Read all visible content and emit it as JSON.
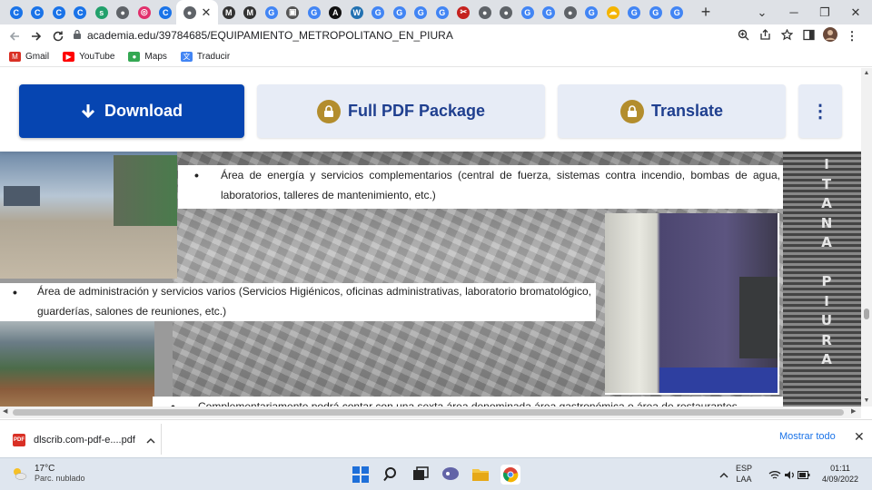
{
  "tabs": {
    "favicons": [
      {
        "name": "chrome-tab-icon",
        "color": "#1a73e8",
        "glyph": "C"
      },
      {
        "name": "chrome-tab-icon",
        "color": "#1a73e8",
        "glyph": "C"
      },
      {
        "name": "chrome-tab-icon",
        "color": "#1a73e8",
        "glyph": "C"
      },
      {
        "name": "chrome-tab-icon",
        "color": "#1a73e8",
        "glyph": "C"
      },
      {
        "name": "scribd-tab-icon",
        "color": "#22a06b",
        "glyph": "s"
      },
      {
        "name": "globe-tab-icon",
        "color": "#5f6368",
        "glyph": "●"
      },
      {
        "name": "instagram-tab-icon",
        "color": "#e1306c",
        "glyph": "◎"
      },
      {
        "name": "chrome-tab-icon",
        "color": "#1a73e8",
        "glyph": "C"
      },
      {
        "name": "globe-tab-icon",
        "color": "#5f6368",
        "glyph": "●"
      },
      {
        "name": "m-tab-icon",
        "color": "#333333",
        "glyph": "M"
      },
      {
        "name": "m-tab-icon",
        "color": "#333333",
        "glyph": "M"
      },
      {
        "name": "google-tab-icon",
        "color": "#4285f4",
        "glyph": "G"
      },
      {
        "name": "image-tab-icon",
        "color": "#555555",
        "glyph": "▣"
      },
      {
        "name": "google-tab-icon",
        "color": "#4285f4",
        "glyph": "G"
      },
      {
        "name": "a-tab-icon",
        "color": "#111111",
        "glyph": "A"
      },
      {
        "name": "wordpress-tab-icon",
        "color": "#2271b1",
        "glyph": "W"
      },
      {
        "name": "google-tab-icon",
        "color": "#4285f4",
        "glyph": "G"
      },
      {
        "name": "google-tab-icon",
        "color": "#4285f4",
        "glyph": "G"
      },
      {
        "name": "google-tab-icon",
        "color": "#4285f4",
        "glyph": "G"
      },
      {
        "name": "google-tab-icon",
        "color": "#4285f4",
        "glyph": "G"
      },
      {
        "name": "tools-tab-icon",
        "color": "#c5221f",
        "glyph": "✂"
      },
      {
        "name": "globe-tab-icon",
        "color": "#5f6368",
        "glyph": "●"
      },
      {
        "name": "globe-tab-icon",
        "color": "#5f6368",
        "glyph": "●"
      },
      {
        "name": "google-tab-icon",
        "color": "#4285f4",
        "glyph": "G"
      },
      {
        "name": "google-tab-icon",
        "color": "#4285f4",
        "glyph": "G"
      },
      {
        "name": "globe-tab-icon",
        "color": "#5f6368",
        "glyph": "●"
      },
      {
        "name": "google-tab-icon",
        "color": "#4285f4",
        "glyph": "G"
      },
      {
        "name": "cloud-tab-icon",
        "color": "#f4b400",
        "glyph": "☁"
      },
      {
        "name": "google-tab-icon",
        "color": "#4285f4",
        "glyph": "G"
      },
      {
        "name": "google-tab-icon",
        "color": "#4285f4",
        "glyph": "G"
      },
      {
        "name": "google-tab-icon",
        "color": "#4285f4",
        "glyph": "G"
      }
    ],
    "active_index": 8,
    "new_tab": "+"
  },
  "window": {
    "minimize": "─",
    "restore": "❐",
    "close": "✕",
    "tab_search": "⌄"
  },
  "toolbar": {
    "url": "academia.edu/39784685/EQUIPAMIENTO_METROPOLITANO_EN_PIURA"
  },
  "bookmarks": [
    {
      "label": "Gmail",
      "icon": "gmail-icon",
      "color": "#d93025",
      "glyph": "M"
    },
    {
      "label": "YouTube",
      "icon": "youtube-icon",
      "color": "#ff0000",
      "glyph": "▶"
    },
    {
      "label": "Maps",
      "icon": "maps-icon",
      "color": "#34a853",
      "glyph": "●"
    },
    {
      "label": "Traducir",
      "icon": "translate-icon",
      "color": "#4285f4",
      "glyph": "文"
    }
  ],
  "actions": {
    "download": "Download",
    "full_pdf": "Full PDF Package",
    "translate": "Translate",
    "more": "⋮"
  },
  "document": {
    "bullet1": "Área de energía y servicios complementarios (central de fuerza, sistemas contra incendio, bombas de agua, laboratorios, talleres de mantenimiento, etc.)",
    "bullet2": "Área de administración y servicios varios (Servicios Higiénicos, oficinas administrativas, laboratorio bromatológico, guarderías, salones de reuniones, etc.)",
    "bullet3": "Complementariamente podrá contar con una sexta área denominada área gastronómica o área de restaurantes",
    "vertical_word": [
      "I",
      "T",
      "A",
      "N",
      "A",
      "",
      "P",
      "I",
      "U",
      "R",
      "A"
    ]
  },
  "downloads": {
    "file": "dlscrib.com-pdf-e....pdf",
    "show_all": "Mostrar todo",
    "close": "✕"
  },
  "taskbar": {
    "temperature": "17°C",
    "weather": "Parc. nublado",
    "lang1": "ESP",
    "lang2": "LAA",
    "time": "01:11",
    "date": "4/09/2022"
  }
}
